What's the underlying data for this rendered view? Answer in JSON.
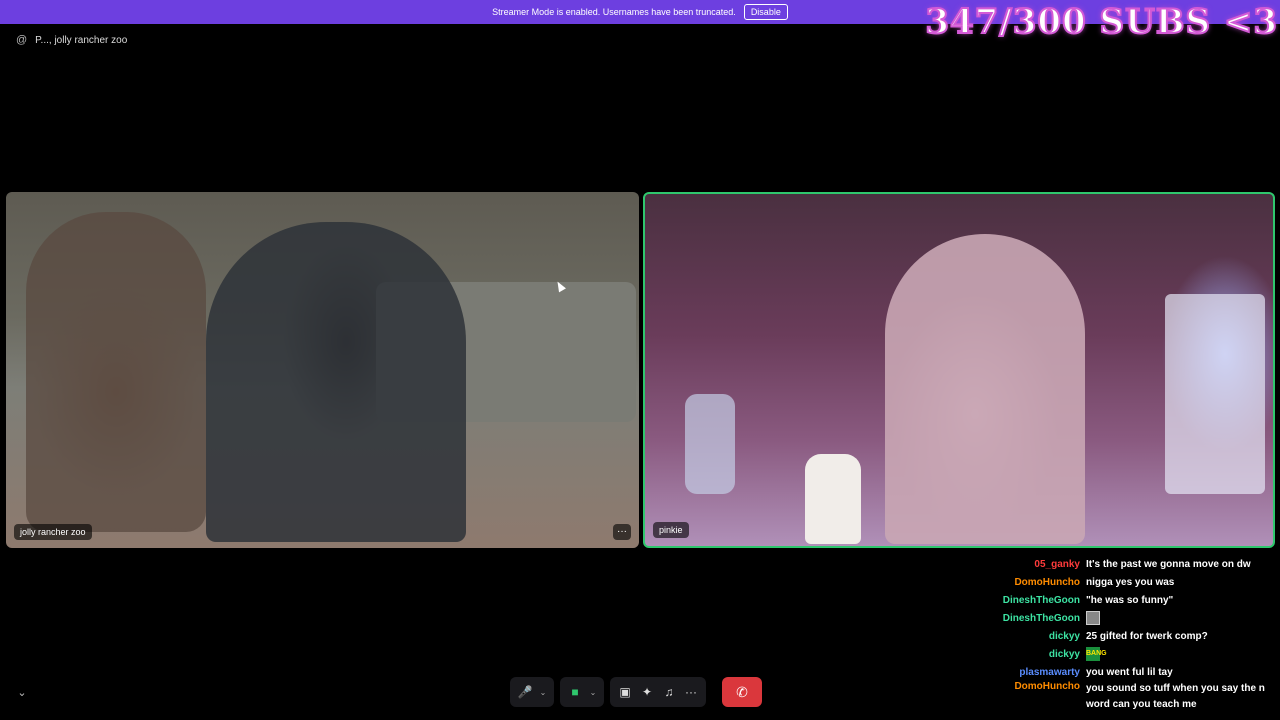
{
  "banner": {
    "text": "Streamer Mode is enabled. Usernames have been truncated.",
    "button": "Disable"
  },
  "subgoal": "347/300 SUBS <3",
  "channel": {
    "icon": "at-icon",
    "name": "P..., jolly rancher zoo"
  },
  "tiles": [
    {
      "name": "jolly rancher zoo",
      "more": "···"
    },
    {
      "name": "pinkie"
    }
  ],
  "controls": {
    "mic": "🎤",
    "cam": "■",
    "share": "▣",
    "activities": "✦",
    "soundboard": "♫",
    "more": "···",
    "end_call": "✆",
    "caret": "⌄",
    "collapse": "⌄"
  },
  "chat": [
    {
      "user": "05_ganky",
      "color": "#ff3b3b",
      "msg": "It's the past we gonna move on dw"
    },
    {
      "user": "DomoHuncho",
      "color": "#ff8c00",
      "msg": "nigga yes you was"
    },
    {
      "user": "DineshTheGoon",
      "color": "#3de3a3",
      "msg": "\"he was so funny\""
    },
    {
      "user": "DineshTheGoon",
      "color": "#3de3a3",
      "msg": ""
    },
    {
      "user": "dickyy",
      "color": "#3de3a3",
      "msg": "25 gifted for twerk comp?"
    },
    {
      "user": "dickyy",
      "color": "#3de3a3",
      "msg": "BANG"
    },
    {
      "user": "plasmawarty",
      "color": "#5a8dff",
      "msg": "you went ful lil tay"
    },
    {
      "user": "DomoHuncho",
      "color": "#ff8c00",
      "msg": "you sound so tuff when you say the n word can you teach me"
    }
  ]
}
